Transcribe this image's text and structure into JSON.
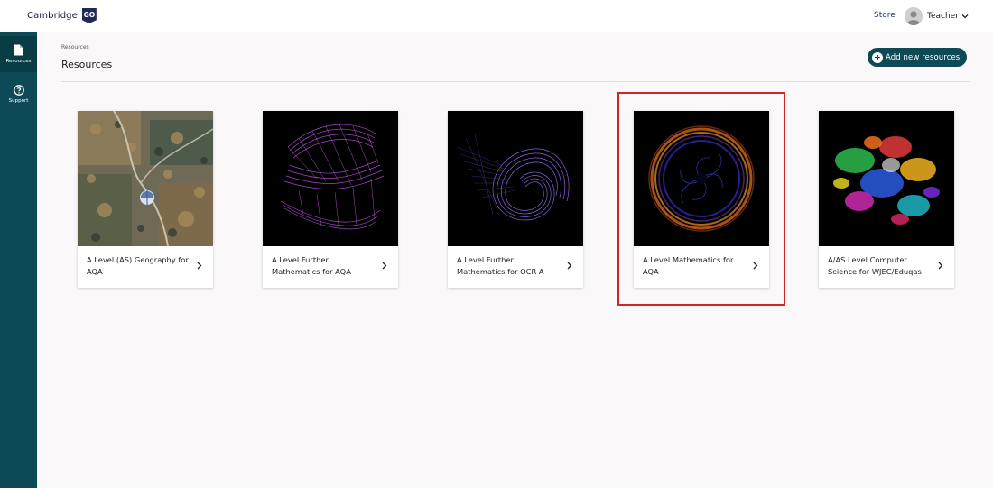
{
  "header": {
    "logo_text": "Cambridge",
    "logo_badge": "GO",
    "store_label": "Store",
    "user_label": "Teacher"
  },
  "sidebar": {
    "items": [
      {
        "label": "Resources",
        "icon": "document-icon",
        "active": true
      },
      {
        "label": "Support",
        "icon": "help-circle-icon",
        "active": false
      }
    ]
  },
  "main": {
    "breadcrumb": "Resources",
    "title": "Resources",
    "add_button_label": "Add new resources",
    "cards": [
      {
        "title": "A Level (AS) Geography for AQA",
        "image": "aerial-landscape-balloon"
      },
      {
        "title": "A Level Further Mathematics for AQA",
        "image": "purple-string-art-s"
      },
      {
        "title": "A Level Further Mathematics for OCR A",
        "image": "purple-spiral-lines"
      },
      {
        "title": "A Level Mathematics for AQA",
        "image": "orange-blue-ring",
        "highlighted": true
      },
      {
        "title": "A/AS Level Computer Science for WJEC/Eduqas",
        "image": "colourful-paint-splash"
      }
    ]
  },
  "colors": {
    "brand_teal": "#0e4a55",
    "highlight_red": "#d32525",
    "background": "#faf8f8"
  }
}
